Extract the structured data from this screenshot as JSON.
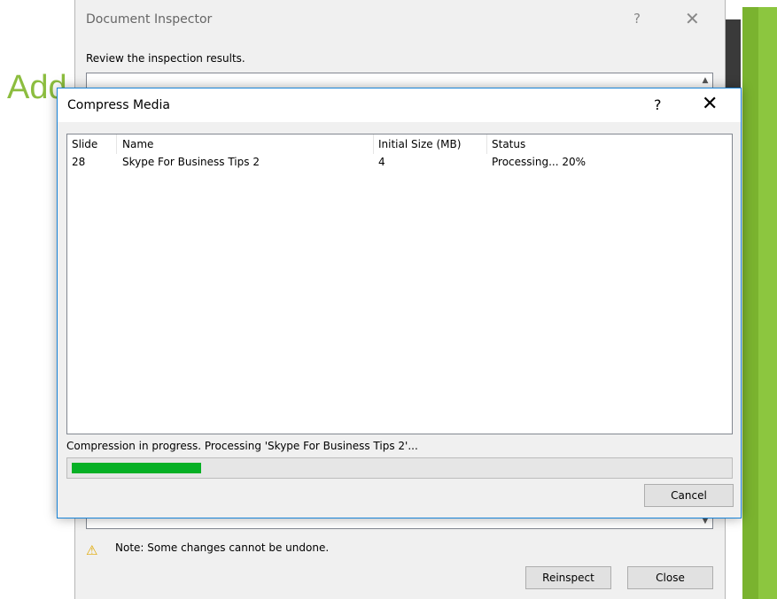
{
  "background": {
    "slide_title_fragment": "Add"
  },
  "document_inspector": {
    "title": "Document Inspector",
    "help_glyph": "?",
    "close_glyph": "✕",
    "review_text": "Review the inspection results.",
    "note_text": "Note: Some changes cannot be undone.",
    "reinspect_label": "Reinspect",
    "close_label": "Close"
  },
  "compress_media": {
    "title": "Compress Media",
    "help_glyph": "?",
    "close_glyph": "✕",
    "columns": [
      "Slide",
      "Name",
      "Initial Size (MB)",
      "Status"
    ],
    "rows": [
      {
        "slide": "28",
        "name": "Skype For Business Tips 2",
        "size": "4",
        "status": "Processing... 20%"
      }
    ],
    "progress_text": "Compression in progress. Processing 'Skype For Business Tips 2'...",
    "progress_fraction": 0.2,
    "cancel_label": "Cancel"
  },
  "colors": {
    "accent_green": "#06b025",
    "dialog_border": "#1883d7",
    "slide_green": "#8cc63f"
  }
}
